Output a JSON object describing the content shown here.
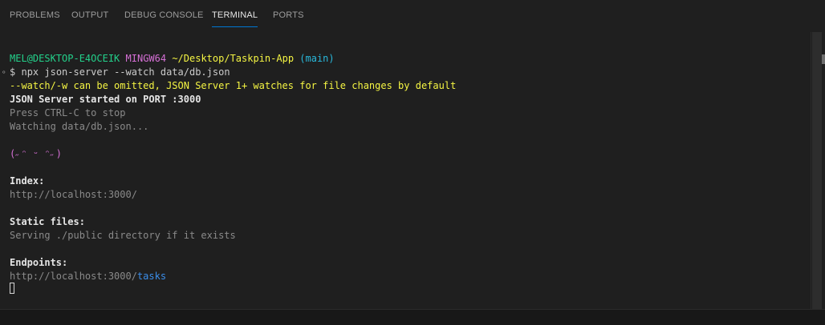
{
  "tabs": [
    {
      "label": "PROBLEMS"
    },
    {
      "label": "OUTPUT"
    },
    {
      "label": "DEBUG CONSOLE"
    },
    {
      "label": "TERMINAL"
    },
    {
      "label": "PORTS"
    }
  ],
  "active_tab": "TERMINAL",
  "terminal": {
    "prompt": {
      "user_host": "MEL@DESKTOP-E4OCEIK",
      "shell": "MINGW64",
      "path": "~/Desktop/Taskpin-App",
      "branch": "(main)"
    },
    "command_prefix": "$",
    "command": "npx json-server --watch data/db.json",
    "warning": "--watch/-w can be omitted, JSON Server 1+ watches for file changes by default",
    "started": "JSON Server started on PORT :3000",
    "press_stop": "Press CTRL-C to stop",
    "watching": "Watching data/db.json...",
    "emoticon": "(˶ᵔ ᵕ ᵔ˶)",
    "index_label": "Index:",
    "index_url": "http://localhost:3000/",
    "static_label": "Static files:",
    "static_text": "Serving ./public directory if it exists",
    "endpoints_label": "Endpoints:",
    "endpoint_base": "http://localhost:3000/",
    "endpoint_path": "tasks"
  },
  "colors": {
    "background": "#1f1f1f",
    "prompt_user": "#23d18b",
    "prompt_shell": "#d670d6",
    "prompt_path": "#f5f543",
    "prompt_branch": "#29b8db",
    "warning": "#f5f543",
    "endpoint_path": "#3b8eea",
    "active_tab_underline": "#0078d4"
  }
}
